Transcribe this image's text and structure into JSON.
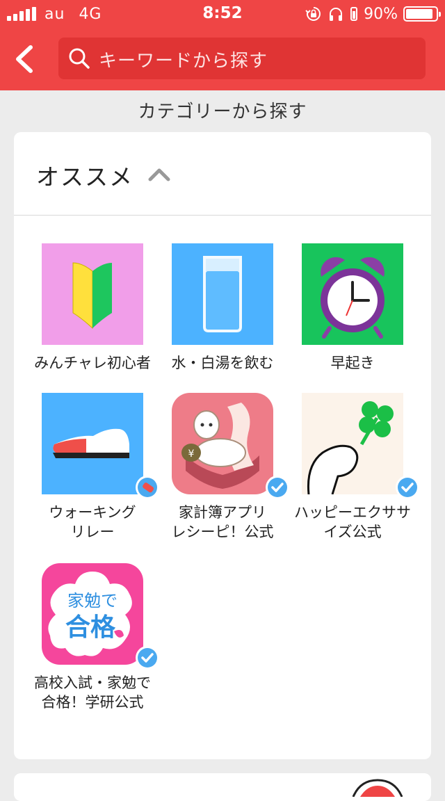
{
  "status_bar": {
    "carrier": "au",
    "network": "4G",
    "time": "8:52",
    "battery_percent": "90%",
    "battery_level": 0.9
  },
  "nav": {
    "back_icon": "chevron-left-icon",
    "search_placeholder": "キーワードから探す",
    "search_icon": "search-icon"
  },
  "section_heading": "カテゴリーから探す",
  "category": {
    "title": "オススメ",
    "expanded": true,
    "toggle_icon": "chevron-up-icon"
  },
  "tiles": [
    {
      "label": "みんチャレ初心者",
      "icon": "beginner-mark-icon",
      "badge": null
    },
    {
      "label": "水・白湯を飲む",
      "icon": "water-glass-icon",
      "badge": null
    },
    {
      "label": "早起き",
      "icon": "alarm-clock-icon",
      "badge": null
    },
    {
      "label": "ウォーキング\nリレー",
      "icon": "shoe-icon",
      "badge": "relay-badge-icon"
    },
    {
      "label": "家計簿アプリ\nレシーピ！公式",
      "icon": "alpaca-receipt-app-icon",
      "badge": "verified-badge-icon"
    },
    {
      "label": "ハッピーエクササ\nイズ公式",
      "icon": "clover-hand-icon",
      "badge": "verified-badge-icon"
    },
    {
      "label": "高校入試・家勉で\n合格！学研公式",
      "icon": "study-pass-app-icon",
      "icon_text_line1": "家勉で",
      "icon_text_line2": "合格",
      "badge": "verified-badge-icon"
    }
  ],
  "colors": {
    "brand_red": "#ef4545",
    "search_bg": "#e03434",
    "page_bg": "#ececec",
    "verified_blue": "#4aa9f0"
  }
}
